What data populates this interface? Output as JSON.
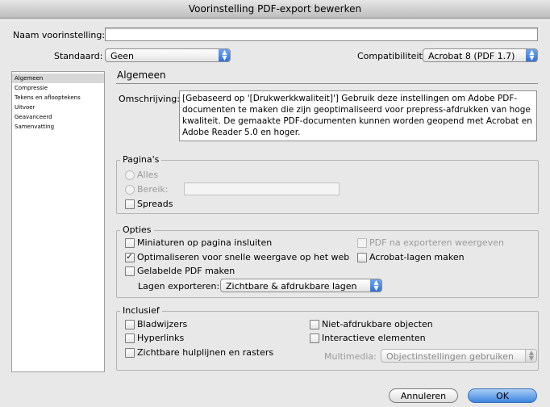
{
  "window": {
    "title": "Voorinstelling PDF-export bewerken"
  },
  "top": {
    "preset_name_label": "Naam voorinstelling:",
    "preset_name_value": "",
    "standard_label": "Standaard:",
    "standard_value": "Geen",
    "compat_label": "Compatibiliteit:",
    "compat_value": "Acrobat 8 (PDF 1.7)"
  },
  "sidebar": {
    "items": [
      {
        "label": "Algemeen",
        "selected": true
      },
      {
        "label": "Compressie"
      },
      {
        "label": "Tekens en aflooptekens"
      },
      {
        "label": "Uitvoer"
      },
      {
        "label": "Geavanceerd"
      },
      {
        "label": "Samenvatting"
      }
    ]
  },
  "main": {
    "section_title": "Algemeen",
    "description_label": "Omschrijving:",
    "description_text": "[Gebaseerd op '[Drukwerkkwaliteit]'] Gebruik deze instellingen om Adobe PDF-documenten te maken die zijn geoptimaliseerd voor prepress-afdrukken van hoge kwaliteit. De gemaakte PDF-documenten kunnen worden geopend met Acrobat en Adobe Reader 5.0 en hoger."
  },
  "pages": {
    "title": "Pagina's",
    "all_label": "Alles",
    "range_label": "Bereik:",
    "range_value": "",
    "spreads_label": "Spreads"
  },
  "options": {
    "title": "Opties",
    "thumbnails_label": "Miniaturen op pagina insluiten",
    "optimize_label": "Optimaliseren voor snelle weergave op het web",
    "tagged_label": "Gelabelde PDF maken",
    "view_after_label": "PDF na exporteren weergeven",
    "acrobat_layers_label": "Acrobat-lagen maken",
    "export_layers_label": "Lagen exporteren:",
    "export_layers_value": "Zichtbare & afdrukbare lagen"
  },
  "include": {
    "title": "Inclusief",
    "bookmarks_label": "Bladwijzers",
    "hyperlinks_label": "Hyperlinks",
    "guides_label": "Zichtbare hulplijnen en rasters",
    "nonprint_label": "Niet-afdrukbare objecten",
    "interactive_label": "Interactieve elementen",
    "multimedia_label": "Multimedia:",
    "multimedia_value": "Objectinstellingen gebruiken"
  },
  "buttons": {
    "cancel": "Annuleren",
    "ok": "OK"
  }
}
